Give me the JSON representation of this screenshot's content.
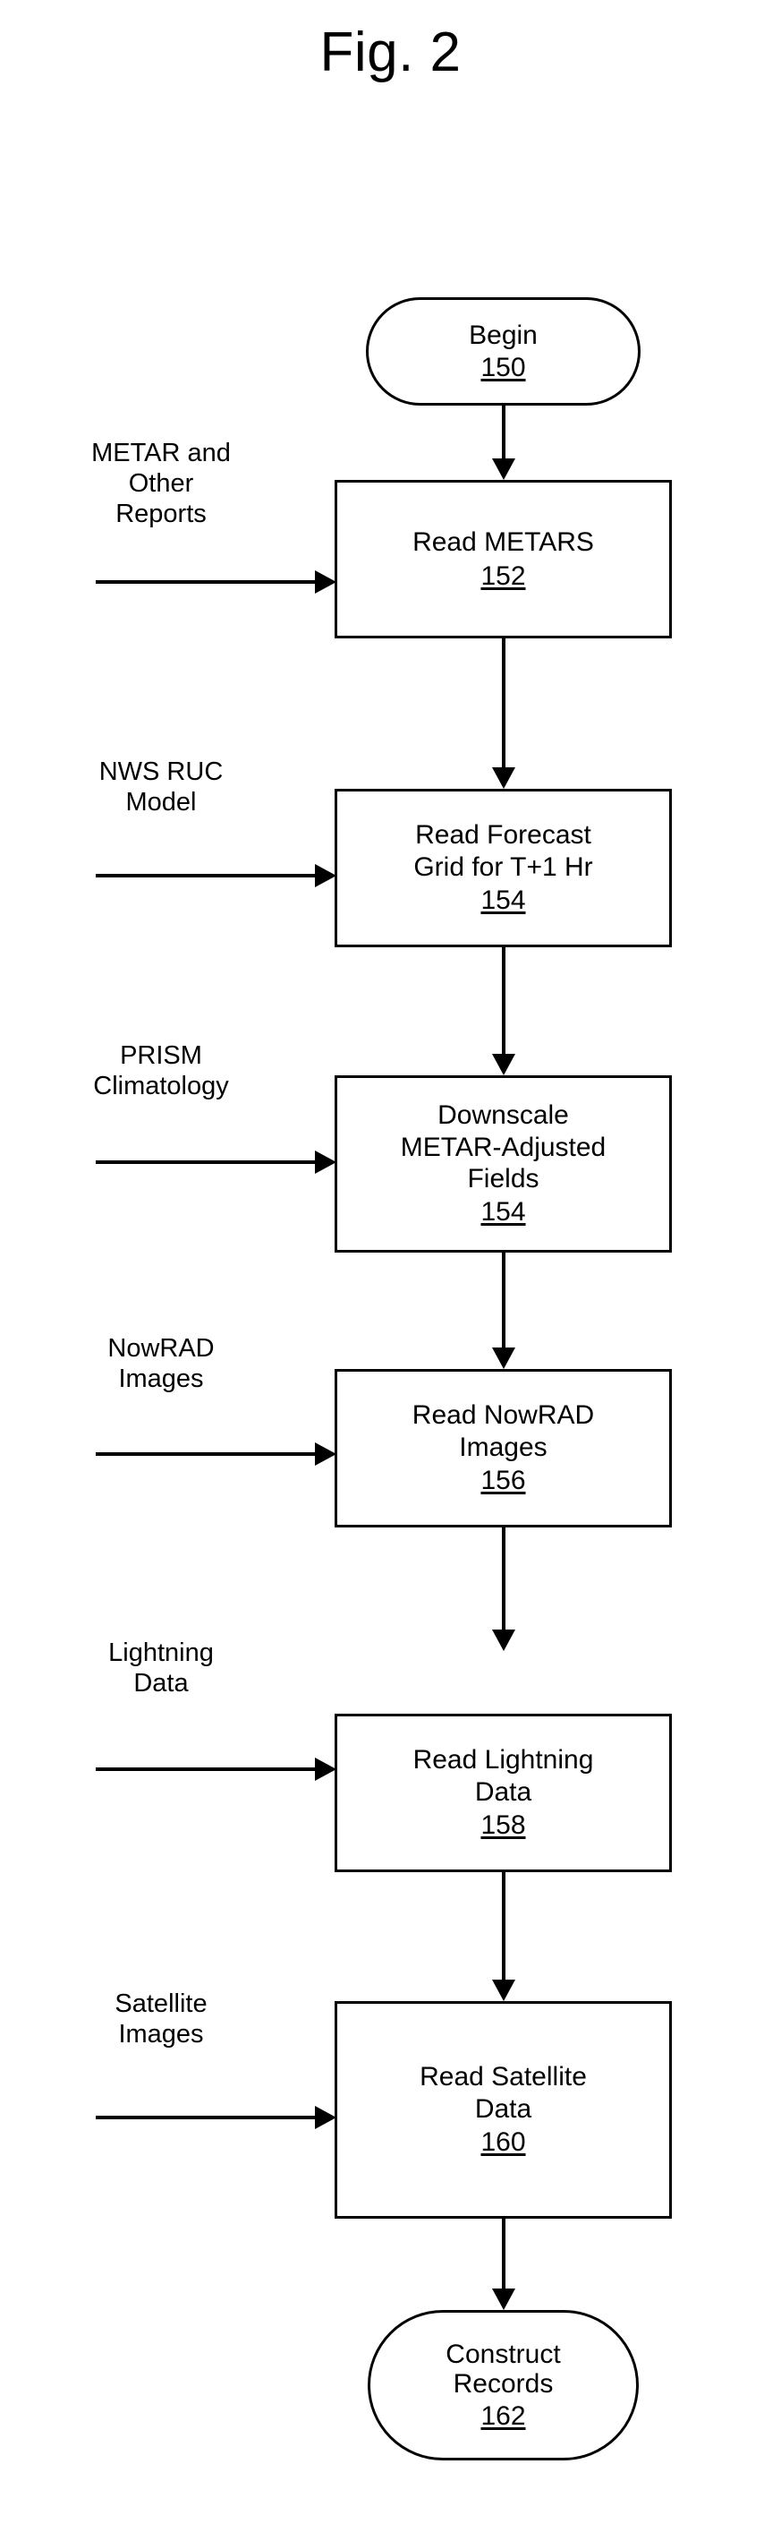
{
  "figure": {
    "title": "Fig. 2"
  },
  "nodes": [
    {
      "id": "begin",
      "shape": "terminator",
      "label": "Begin",
      "ref": "150"
    },
    {
      "id": "read-metars",
      "shape": "process",
      "label": "Read METARS",
      "ref": "152"
    },
    {
      "id": "read-forecast-grid",
      "shape": "process",
      "label_line1": "Read Forecast",
      "label_line2": "Grid for T+1 Hr",
      "ref": "154"
    },
    {
      "id": "downscale-fields",
      "shape": "process",
      "label_line1": "Downscale",
      "label_line2": "METAR-Adjusted",
      "label_line3": "Fields",
      "ref": "154"
    },
    {
      "id": "read-nowrad",
      "shape": "process",
      "label_line1": "Read NowRAD",
      "label_line2": "Images",
      "ref": "156"
    },
    {
      "id": "read-lightning",
      "shape": "process",
      "label_line1": "Read Lightning",
      "label_line2": "Data",
      "ref": "158"
    },
    {
      "id": "read-satellite",
      "shape": "process",
      "label_line1": "Read Satellite",
      "label_line2": "Data",
      "ref": "160"
    },
    {
      "id": "construct-records",
      "shape": "terminator",
      "label_line1": "Construct",
      "label_line2": "Records",
      "ref": "162"
    }
  ],
  "inputs": [
    {
      "id": "metar-input",
      "text": "METAR and\nOther\nReports"
    },
    {
      "id": "nws-ruc-input",
      "text": "NWS RUC\nModel"
    },
    {
      "id": "prism-input",
      "text": "PRISM\nClimatology"
    },
    {
      "id": "nowrad-input",
      "text": "NowRAD\nImages"
    },
    {
      "id": "lightning-input",
      "text": "Lightning\nData"
    },
    {
      "id": "satellite-input",
      "text": "Satellite\nImages"
    }
  ],
  "colors": {
    "stroke": "#000000",
    "background": "#ffffff"
  },
  "chart_data": {
    "type": "diagram",
    "diagram_kind": "flowchart",
    "title": "Fig. 2",
    "orientation": "top-to-bottom",
    "steps": [
      {
        "ref": "150",
        "text": "Begin",
        "shape": "terminator"
      },
      {
        "ref": "152",
        "text": "Read METARS",
        "shape": "process",
        "side_input": "METAR and Other Reports"
      },
      {
        "ref": "154",
        "text": "Read Forecast Grid for T+1 Hr",
        "shape": "process",
        "side_input": "NWS RUC Model"
      },
      {
        "ref": "154",
        "text": "Downscale METAR-Adjusted Fields",
        "shape": "process",
        "side_input": "PRISM Climatology"
      },
      {
        "ref": "156",
        "text": "Read NowRAD Images",
        "shape": "process",
        "side_input": "NowRAD Images"
      },
      {
        "ref": "158",
        "text": "Read Lightning Data",
        "shape": "process",
        "side_input": "Lightning Data"
      },
      {
        "ref": "160",
        "text": "Read Satellite Data",
        "shape": "process",
        "side_input": "Satellite Images"
      },
      {
        "ref": "162",
        "text": "Construct Records",
        "shape": "terminator"
      }
    ],
    "edges": [
      {
        "from": "150",
        "to": "152"
      },
      {
        "from": "152",
        "to": "154"
      },
      {
        "from": "154",
        "to": "154"
      },
      {
        "from": "154",
        "to": "156"
      },
      {
        "from": "156",
        "to": "158"
      },
      {
        "from": "158",
        "to": "160"
      },
      {
        "from": "160",
        "to": "162"
      }
    ]
  }
}
